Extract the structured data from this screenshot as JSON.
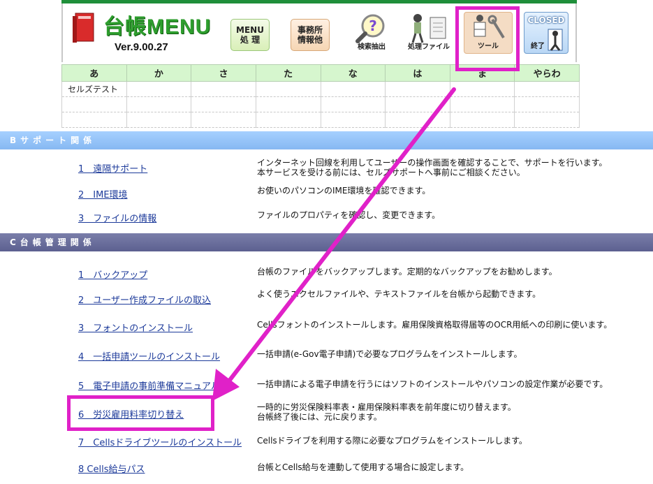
{
  "header": {
    "title": "台帳MENU",
    "version": "Ver.9.00.27",
    "buttons": {
      "menu": "MENU\n処 理",
      "office": "事務所\n情報他",
      "search": "検索抽出",
      "files": "処理ファイル",
      "tools": "ツール",
      "closed": "CLOSED",
      "closed_sub": "終了"
    }
  },
  "kana_table": {
    "headers": [
      "あ",
      "か",
      "さ",
      "た",
      "な",
      "は",
      "ま",
      "やらわ"
    ],
    "rows": [
      [
        "セルズテスト",
        "",
        "",
        "",
        "",
        "",
        "",
        ""
      ],
      [
        "",
        "",
        "",
        "",
        "",
        "",
        "",
        ""
      ],
      [
        "",
        "",
        "",
        "",
        "",
        "",
        "",
        ""
      ]
    ]
  },
  "section_b": {
    "title": "Bサポート関係",
    "items": [
      {
        "link": "1　遠隔サポート",
        "desc1": "インターネット回線を利用してユーザーの操作画面を確認することで、サポートを行います。",
        "desc2": "本サービスを受ける前には、セルズサポートへ事前にご相談ください。"
      },
      {
        "link": "2　IME環境",
        "desc1": "お使いのパソコンのIME環境を確認できます。",
        "desc2": ""
      },
      {
        "link": "3　ファイルの情報",
        "desc1": "ファイルのプロパティを確認し、変更できます。",
        "desc2": ""
      }
    ]
  },
  "section_c": {
    "title": "C台帳管理関係",
    "items": [
      {
        "link": "1　バックアップ",
        "desc1": "台帳のファイルをバックアップします。定期的なバックアップをお勧めします。",
        "desc2": ""
      },
      {
        "link": "2　ユーザー作成ファイルの取込",
        "desc1": "よく使うエクセルファイルや、テキストファイルを台帳から起動できます。",
        "desc2": ""
      },
      {
        "link": "3　フォントのインストール",
        "desc1": "Cellsフォントのインストールします。雇用保険資格取得届等のOCR用紙への印刷に使います。",
        "desc2": ""
      },
      {
        "link": "4　一括申請ツールのインストール",
        "desc1": "一括申請(e-Gov電子申請)で必要なプログラムをインストールします。",
        "desc2": ""
      },
      {
        "link": "5　電子申請の事前準備マニュアル",
        "desc1": "一括申請による電子申請を行うにはソフトのインストールやパソコンの設定作業が必要です。",
        "desc2": ""
      },
      {
        "link": "6　労災雇用料率切り替え",
        "desc1": "一時的に労災保険料率表・雇用保険料率表を前年度に切り替えます。",
        "desc2": "台帳終了後には、元に戻ります。"
      },
      {
        "link": "7　Cellsドライブツールのインストール",
        "desc1": "Cellsドライブを利用する際に必要なプログラムをインストールします。",
        "desc2": ""
      },
      {
        "link": "8 Cells給与パス",
        "desc1": "台帳とCells給与を連動して使用する場合に設定します。",
        "desc2": ""
      }
    ]
  },
  "colors": {
    "highlight": "#e021c8",
    "header_green": "#1f8f3a",
    "section_b": "#9ac8fc",
    "section_c": "#686c9c"
  }
}
